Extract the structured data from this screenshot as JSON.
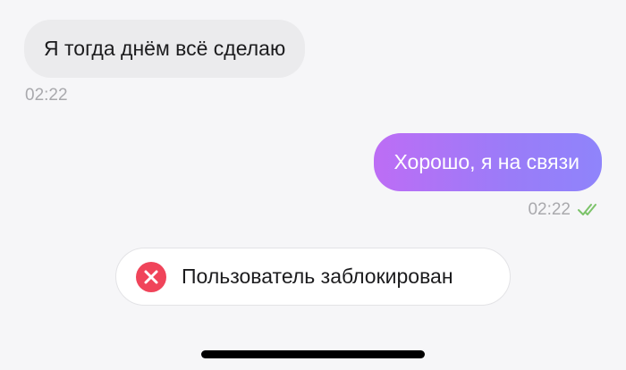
{
  "messages": [
    {
      "direction": "incoming",
      "text": "Я тогда днём всё сделаю",
      "time": "02:22"
    },
    {
      "direction": "outgoing",
      "text": "Хорошо, я на связи",
      "time": "02:22",
      "status_icon": "double-check-icon"
    }
  ],
  "notice": {
    "icon": "error-x-icon",
    "text": "Пользователь заблокирован"
  },
  "colors": {
    "background": "#f6f6f8",
    "incoming_bubble": "#ebebed",
    "outgoing_gradient_start": "#bd6df5",
    "outgoing_gradient_end": "#8f84fb",
    "read_check": "#7cc36a",
    "error_red": "#f0445a",
    "timestamp": "#a9a9ad"
  }
}
